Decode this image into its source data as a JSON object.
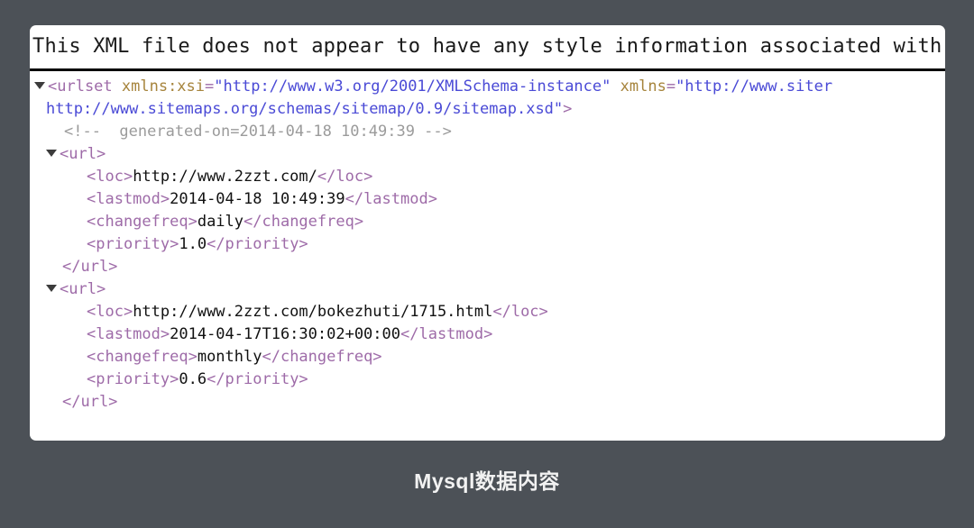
{
  "page": {
    "background_color": "#4c5157",
    "caption": "Mysql数据内容"
  },
  "viewer": {
    "panel_background": "#ffffff",
    "notice": "This XML file does not appear to have any style information associated with",
    "notice_truncated": true,
    "colors": {
      "tag": "#9e6ba8",
      "attribute_name": "#a6843c",
      "attribute_value": "#4a4ad6",
      "comment": "#9b9b9b",
      "text": "#111111"
    }
  },
  "xml": {
    "root_open_prefix": "<urlset ",
    "root_attr1_name": "xmlns:xsi",
    "root_attr1_eq": "=",
    "root_attr1_value": "\"http://www.w3.org/2001/XMLSchema-instance\"",
    "root_attr2_name": "xmlns",
    "root_attr2_eq": "=",
    "root_attr2_value_part1": "\"http://www.siter",
    "root_attr2_value_part2": "http://www.sitemaps.org/schemas/sitemap/0.9/sitemap.xsd\"",
    "root_open_suffix": ">",
    "comment": "<!--  generated-on=2014-04-18 10:49:39 -->",
    "url_open": "<url>",
    "url_close": "</url>",
    "entries": [
      {
        "loc_open": "<loc>",
        "loc_value": "http://www.2zzt.com/",
        "loc_close": "</loc>",
        "lastmod_open": "<lastmod>",
        "lastmod_value": "2014-04-18 10:49:39",
        "lastmod_close": "</lastmod>",
        "changefreq_open": "<changefreq>",
        "changefreq_value": "daily",
        "changefreq_close": "</changefreq>",
        "priority_open": "<priority>",
        "priority_value": "1.0",
        "priority_close": "</priority>"
      },
      {
        "loc_open": "<loc>",
        "loc_value": "http://www.2zzt.com/bokezhuti/1715.html",
        "loc_close": "</loc>",
        "lastmod_open": "<lastmod>",
        "lastmod_value": "2014-04-17T16:30:02+00:00",
        "lastmod_close": "</lastmod>",
        "changefreq_open": "<changefreq>",
        "changefreq_value": "monthly",
        "changefreq_close": "</changefreq>",
        "priority_open": "<priority>",
        "priority_value": "0.6",
        "priority_close": "</priority>"
      }
    ]
  }
}
